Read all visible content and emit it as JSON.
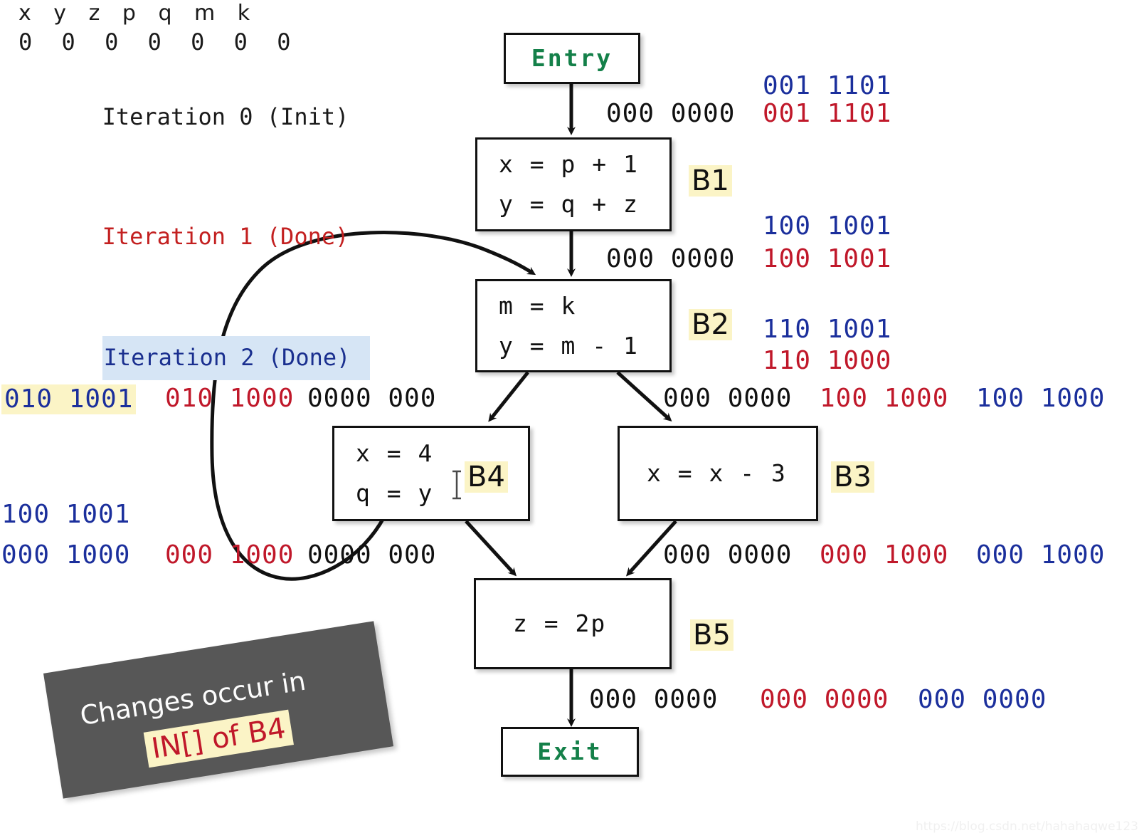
{
  "legend": {
    "variables": "x y z p q m k",
    "initial_values": "0 0 0 0 0 0 0",
    "iterations": [
      {
        "label": "Iteration 0 (Init)",
        "color": "#1a1a1a"
      },
      {
        "label": "Iteration 1 (Done)",
        "color": "#c32020"
      },
      {
        "label": "Iteration 2 (Done)",
        "color": "#1a2f8f"
      }
    ]
  },
  "cfg": {
    "entry": {
      "label": "Entry",
      "tag": ""
    },
    "exit": {
      "label": "Exit",
      "tag": ""
    },
    "blocks": [
      {
        "tag": "B1",
        "stmts": [
          "x = p + 1",
          "y = q + z"
        ]
      },
      {
        "tag": "B2",
        "stmts": [
          "m = k",
          "y = m - 1"
        ]
      },
      {
        "tag": "B3",
        "stmts": [
          "x = x - 3"
        ]
      },
      {
        "tag": "B4",
        "stmts": [
          "x = 4",
          "q = y"
        ]
      },
      {
        "tag": "B5",
        "stmts": [
          "z = 2p"
        ]
      }
    ]
  },
  "bitvectors": {
    "entry_to_b1": {
      "blue_top": "001 1101",
      "black": "000 0000",
      "red": "001 1101"
    },
    "b1_to_b2": {
      "blue_top": "100 1001",
      "black": "000 0000",
      "red": "100 1001"
    },
    "b2_right": {
      "blue": "110 1001",
      "red": "110 1000"
    },
    "b2_to_b4_left": {
      "blue_hl": "010 1001",
      "red": "010 1000",
      "black": "0000 000"
    },
    "b2_to_b3_right": {
      "black": "000 0000",
      "red": "100 1000",
      "blue": "100 1000"
    },
    "b4_left_upper": {
      "blue": "100 1001"
    },
    "b4_to_b5_left": {
      "blue": "000 1000",
      "red": "000 1000",
      "black": "0000 000"
    },
    "b3_to_b5_right": {
      "black": "000 0000",
      "red": "000 1000",
      "blue": "000 1000"
    },
    "b5_to_exit": {
      "black": "000 0000",
      "red": "000 0000",
      "blue": "000 0000"
    }
  },
  "banner": {
    "line1": "Changes occur in",
    "line2": "IN[] of B4"
  },
  "watermark": "https://blog.csdn.net/hahahaqwe123",
  "colors": {
    "black": "#111111",
    "red": "#c0182a",
    "blue": "#1b2f9c",
    "green": "#148049",
    "highlight_yellow": "#fbf4c6",
    "highlight_blue": "#d6e5f5",
    "banner_bg": "#575757"
  }
}
